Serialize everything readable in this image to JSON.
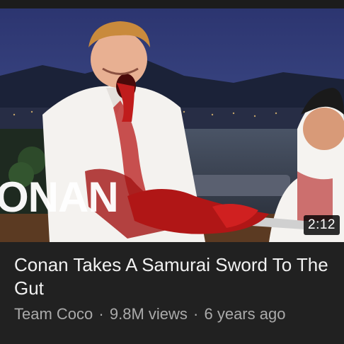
{
  "video": {
    "duration": "2:12",
    "watermark": "ONAN",
    "title": "Conan Takes A Samurai Sword To The Gut",
    "channel": "Team Coco",
    "views": "9.8M views",
    "age": "6 years ago",
    "separator": "·"
  },
  "colors": {
    "background": "#212121",
    "title_text": "#f1f1f1",
    "meta_text": "#aaaaaa",
    "watermark_accent": "#f0a030"
  }
}
